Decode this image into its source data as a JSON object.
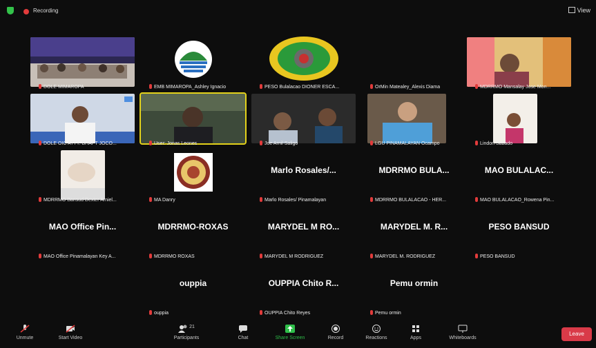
{
  "topbar": {
    "recording_label": "Recording",
    "view_label": "View"
  },
  "tiles": [
    {
      "name": "DOLE MIMAROPA"
    },
    {
      "name": "EMB MIMAROPA_Ashley Ignacio"
    },
    {
      "name": "PESO Bulalacao DIONER ESCA..."
    },
    {
      "name": "OrMin Matealey_Alexis Diama"
    },
    {
      "name": "MDRRMO Mansalay Jose Mon..."
    },
    {
      "name": "DOLE OIC ATTY. BHAPT JOCO..."
    },
    {
      "name": "User: Jonas Leones"
    },
    {
      "name": "Joe Arnil Saligo"
    },
    {
      "name": "LGU PINAMALAYAN Ocampo"
    },
    {
      "name": "Lindon Sabado"
    },
    {
      "name": "MDRRMO Bansud Dexter Arniel..."
    },
    {
      "name": "MA Danry"
    },
    {
      "display": "Marlo Rosales/...",
      "name": "Marlo Rosales/ Pinamalayan"
    },
    {
      "display": "MDRRMO BULA...",
      "name": "MDRRMO BULALACAO - HER..."
    },
    {
      "display": "MAO BULALAC...",
      "name": "MAO BULALACAO_Rowena Pin..."
    },
    {
      "display": "MAO Office Pin...",
      "name": "MAO Office Pinamalayan Key A..."
    },
    {
      "display": "MDRRMO-ROXAS",
      "name": "MDRRMO ROXAS"
    },
    {
      "display": "MARYDEL M RO...",
      "name": "MARYDEL M RODRIGUEZ"
    },
    {
      "display": "MARYDEL M. R...",
      "name": "MARYDEL M. RODRIGUEZ"
    },
    {
      "display": "PESO BANSUD",
      "name": "PESO BANSUD"
    },
    {
      "display": "ouppia",
      "name": "ouppia"
    },
    {
      "display": "OUPPIA Chito R...",
      "name": "OUPPIA Chito Reyes"
    },
    {
      "display": "Pemu ormin",
      "name": "Pemu ormin"
    }
  ],
  "toolbar": {
    "unmute": "Unmute",
    "start_video": "Start Video",
    "participants": "Participants",
    "participants_count": "21",
    "chat": "Chat",
    "share_screen": "Share Screen",
    "record": "Record",
    "reactions": "Reactions",
    "apps": "Apps",
    "whiteboards": "Whiteboards",
    "leave": "Leave"
  },
  "colors": {
    "speaker_highlight": "#e4d21a",
    "share_green": "#2fbf4a",
    "leave_red": "#d93a48",
    "muted_red": "#e23b3b"
  }
}
